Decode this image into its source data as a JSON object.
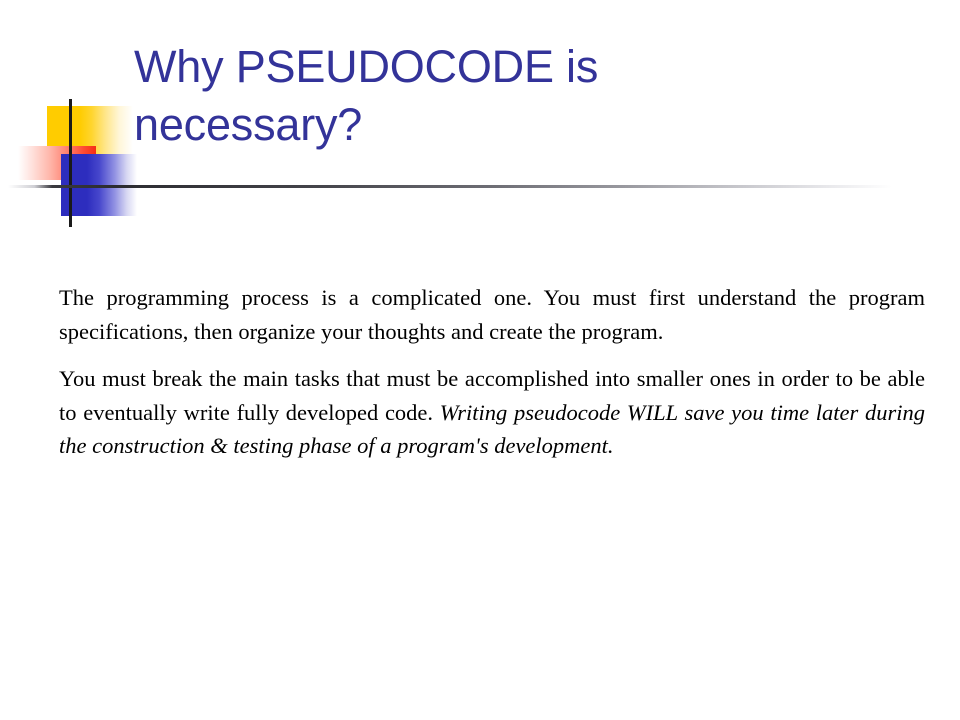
{
  "slide": {
    "title": "Why PSEUDOCODE is necessary?",
    "title_color": "#333399",
    "background_color": "#ffffff",
    "body": {
      "paragraph_1": "The programming process is a complicated one. You must first understand the program specifications, then organize your thoughts and create the program.",
      "paragraph_2_plain": "You must break the main tasks that must be accomplished into smaller ones in order to be able to eventually write fully developed code. ",
      "paragraph_2_italic": "Writing pseudocode WILL save you time later during the construction & testing phase of a program's development."
    },
    "decoration": {
      "name": "powerpoint-corner-blocks",
      "yellow": "#FFCC00",
      "red": "#F52F14",
      "blue": "#2D2DBE",
      "rule": "#2b2b30"
    }
  }
}
